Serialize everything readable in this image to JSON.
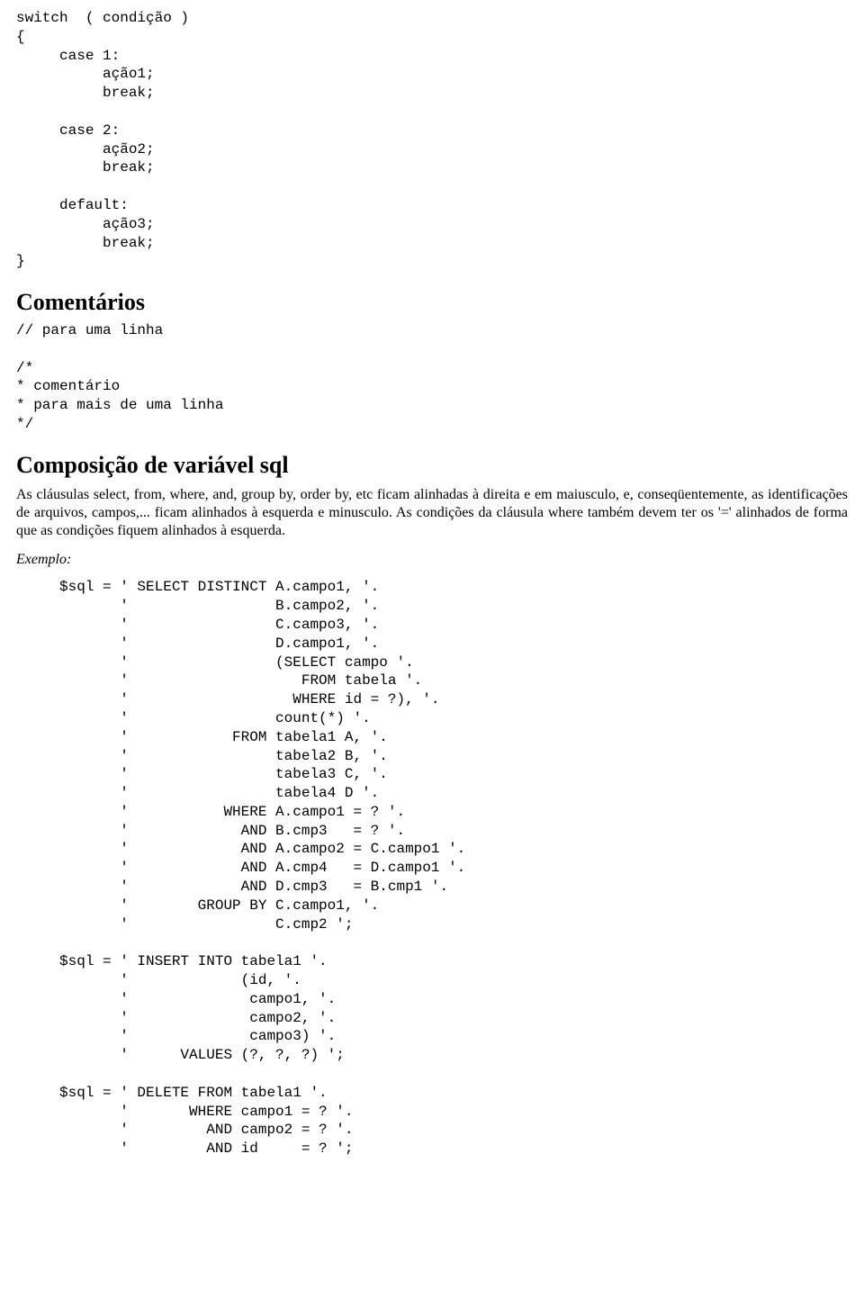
{
  "code1": "switch  ( condição )\n{\n     case 1:\n          ação1;\n          break;\n\n     case 2:\n          ação2;\n          break;\n\n     default:\n          ação3;\n          break;\n}",
  "heading1": "Comentários",
  "code2": "// para uma linha\n\n/*\n* comentário\n* para mais de uma linha\n*/",
  "heading2": "Composição de variável sql",
  "para1": "As cláusulas select, from, where, and, group by, order by, etc ficam alinhadas à direita e em maiusculo, e, conseqüentemente, as identificações de arquivos, campos,... ficam alinhados à esquerda e minusculo. As condições da cláusula where também devem ter os '=' alinhados de forma que as condições fiquem alinhados à esquerda.",
  "exemplo": "Exemplo:",
  "code3": "     $sql = ' SELECT DISTINCT A.campo1, '.\n            '                 B.campo2, '.\n            '                 C.campo3, '.\n            '                 D.campo1, '.\n            '                 (SELECT campo '.\n            '                    FROM tabela '.\n            '                   WHERE id = ?), '.\n            '                 count(*) '.\n            '            FROM tabela1 A, '.\n            '                 tabela2 B, '.\n            '                 tabela3 C, '.\n            '                 tabela4 D '.\n            '           WHERE A.campo1 = ? '.\n            '             AND B.cmp3   = ? '.\n            '             AND A.campo2 = C.campo1 '.\n            '             AND A.cmp4   = D.campo1 '.\n            '             AND D.cmp3   = B.cmp1 '.\n            '        GROUP BY C.campo1, '.\n            '                 C.cmp2 ';\n\n     $sql = ' INSERT INTO tabela1 '.\n            '             (id, '.\n            '              campo1, '.\n            '              campo2, '.\n            '              campo3) '.\n            '      VALUES (?, ?, ?) ';\n\n     $sql = ' DELETE FROM tabela1 '.\n            '       WHERE campo1 = ? '.\n            '         AND campo2 = ? '.\n            '         AND id     = ? ';"
}
